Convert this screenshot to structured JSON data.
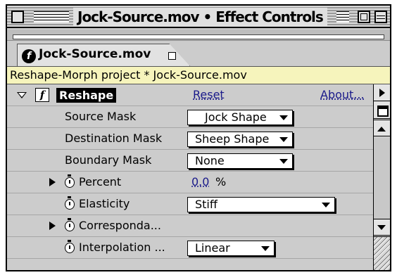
{
  "window": {
    "title": "Jock-Source.mov • Effect Controls"
  },
  "tab": {
    "icon": "effect-f-icon",
    "label": "Jock-Source.mov"
  },
  "project_bar": {
    "text": "Reshape-Morph project * Jock-Source.mov"
  },
  "effect": {
    "fx_symbol": "f",
    "name": "Reshape",
    "reset_label": "Reset",
    "about_label": "About..."
  },
  "properties": {
    "source_mask": {
      "label": "Source Mask",
      "value": "Jock Shape"
    },
    "destination_mask": {
      "label": "Destination Mask",
      "value": "Sheep Shape"
    },
    "boundary_mask": {
      "label": "Boundary Mask",
      "value": "None"
    },
    "percent": {
      "label": "Percent",
      "value": "0.0",
      "unit": "%"
    },
    "elasticity": {
      "label": "Elasticity",
      "value": "Stiff"
    },
    "correspondence": {
      "label": "Corresponda..."
    },
    "interpolation": {
      "label": "Interpolation ...",
      "value": "Linear"
    }
  },
  "icons": {
    "close": "close-box-icon",
    "zoom": "zoom-box-icon",
    "collapse": "collapse-box-icon",
    "twirl": "twirl-triangle-icon",
    "stopwatch": "stopwatch-icon",
    "menu_arrow": "panel-menu-arrow-icon",
    "scroll_up": "scroll-up-arrow-icon",
    "scroll_down": "scroll-down-arrow-icon",
    "resize": "resize-grip-icon"
  },
  "colors": {
    "panel_bg": "#cccccc",
    "project_bar_bg": "#f6f4bc",
    "link": "#1a1a8a"
  }
}
